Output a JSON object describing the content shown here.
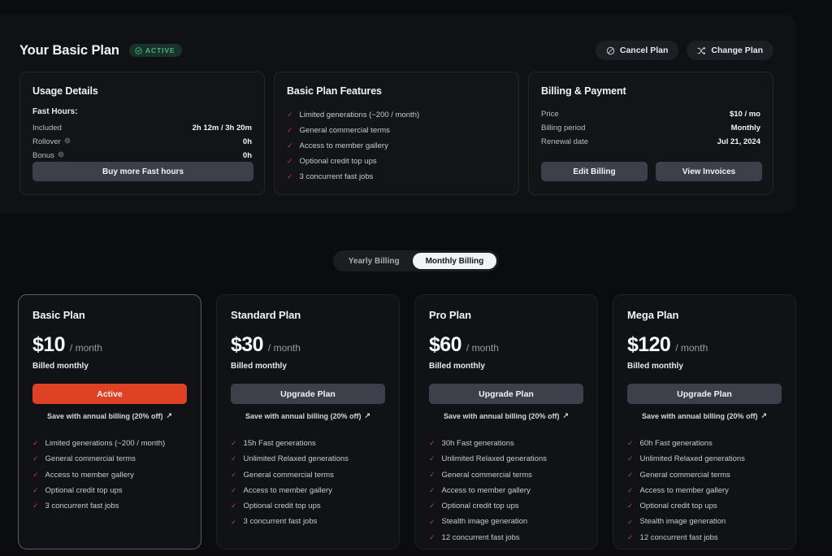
{
  "header": {
    "title": "Your Basic Plan",
    "badge": "ACTIVE",
    "cancel_label": "Cancel Plan",
    "change_label": "Change Plan"
  },
  "usage": {
    "title": "Usage Details",
    "section_label": "Fast Hours:",
    "rows": [
      {
        "key": "Included",
        "value": "2h 12m / 3h 20m",
        "info": false
      },
      {
        "key": "Rollover",
        "value": "0h",
        "info": true
      },
      {
        "key": "Bonus",
        "value": "0h",
        "info": true
      }
    ],
    "buy_label": "Buy more Fast hours"
  },
  "features_card": {
    "title": "Basic Plan Features",
    "items": [
      "Limited generations (~200 / month)",
      "General commercial terms",
      "Access to member gallery",
      "Optional credit top ups",
      "3 concurrent fast jobs"
    ]
  },
  "billing_card": {
    "title": "Billing & Payment",
    "rows": [
      {
        "key": "Price",
        "value": "$10 / mo"
      },
      {
        "key": "Billing period",
        "value": "Monthly"
      },
      {
        "key": "Renewal date",
        "value": "Jul 21, 2024"
      }
    ],
    "edit_label": "Edit Billing",
    "invoices_label": "View Invoices"
  },
  "billing_toggle": {
    "yearly": "Yearly Billing",
    "monthly": "Monthly Billing",
    "selected": "monthly"
  },
  "plans": [
    {
      "name": "Basic Plan",
      "price": "$10",
      "per": "/ month",
      "billed": "Billed monthly",
      "cta": "Active",
      "cta_active": true,
      "save": "Save with annual billing (20% off)",
      "features": [
        "Limited generations (~200 / month)",
        "General commercial terms",
        "Access to member gallery",
        "Optional credit top ups",
        "3 concurrent fast jobs"
      ]
    },
    {
      "name": "Standard Plan",
      "price": "$30",
      "per": "/ month",
      "billed": "Billed monthly",
      "cta": "Upgrade Plan",
      "cta_active": false,
      "save": "Save with annual billing (20% off)",
      "features": [
        "15h Fast generations",
        "Unlimited Relaxed generations",
        "General commercial terms",
        "Access to member gallery",
        "Optional credit top ups",
        "3 concurrent fast jobs"
      ]
    },
    {
      "name": "Pro Plan",
      "price": "$60",
      "per": "/ month",
      "billed": "Billed monthly",
      "cta": "Upgrade Plan",
      "cta_active": false,
      "save": "Save with annual billing (20% off)",
      "features": [
        "30h Fast generations",
        "Unlimited Relaxed generations",
        "General commercial terms",
        "Access to member gallery",
        "Optional credit top ups",
        "Stealth image generation",
        "12 concurrent fast jobs"
      ]
    },
    {
      "name": "Mega Plan",
      "price": "$120",
      "per": "/ month",
      "billed": "Billed monthly",
      "cta": "Upgrade Plan",
      "cta_active": false,
      "save": "Save with annual billing (20% off)",
      "features": [
        "60h Fast generations",
        "Unlimited Relaxed generations",
        "General commercial terms",
        "Access to member gallery",
        "Optional credit top ups",
        "Stealth image generation",
        "12 concurrent fast jobs"
      ]
    }
  ],
  "colors": {
    "accent": "#dd4225",
    "check": "#d33d22",
    "active_badge": "#49b086",
    "page_bg": "#0b0c0f",
    "panel_bg": "#101114"
  }
}
